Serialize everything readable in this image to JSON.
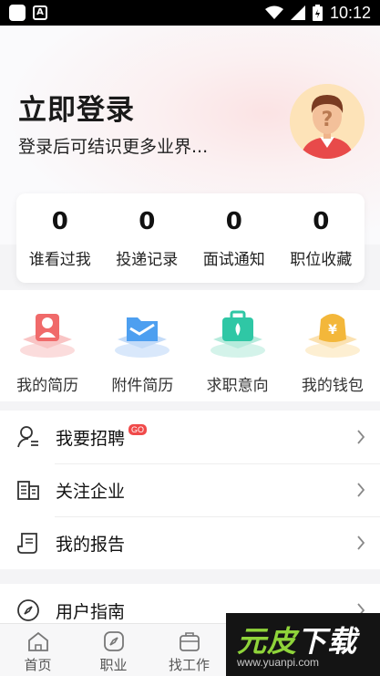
{
  "status_bar": {
    "time": "10:12"
  },
  "header": {
    "title": "立即登录",
    "subtitle": "登录后可结识更多业界..."
  },
  "stats": [
    {
      "value": "0",
      "label": "谁看过我"
    },
    {
      "value": "0",
      "label": "投递记录"
    },
    {
      "value": "0",
      "label": "面试通知"
    },
    {
      "value": "0",
      "label": "职位收藏"
    }
  ],
  "quick_actions": [
    {
      "label": "我的简历",
      "icon": "resume-icon",
      "color": "#f06a6a"
    },
    {
      "label": "附件简历",
      "icon": "folder-icon",
      "color": "#4d9ff0"
    },
    {
      "label": "求职意向",
      "icon": "briefcase-icon",
      "color": "#2fc7a5"
    },
    {
      "label": "我的钱包",
      "icon": "wallet-icon",
      "color": "#f3b73a"
    }
  ],
  "menu": [
    {
      "label": "我要招聘",
      "badge": "GO",
      "icon": "recruit-user-icon"
    },
    {
      "label": "关注企业",
      "icon": "building-icon"
    },
    {
      "label": "我的报告",
      "icon": "report-icon"
    }
  ],
  "menu2": [
    {
      "label": "用户指南",
      "icon": "compass-icon"
    }
  ],
  "tabs": [
    {
      "label": "首页",
      "icon": "home-icon"
    },
    {
      "label": "职业",
      "icon": "compass-icon"
    },
    {
      "label": "找工作",
      "icon": "briefcase-icon"
    }
  ],
  "watermark": {
    "text_a": "元",
    "text_b": "皮",
    "text_c": "下载",
    "url": "www.yuanpi.com"
  }
}
